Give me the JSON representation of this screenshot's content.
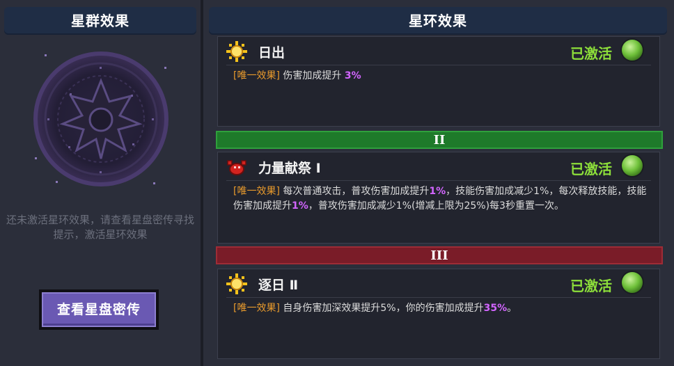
{
  "left": {
    "title": "星群效果",
    "hint": "还未激活星环效果，请查看星盘密传寻找提示，激活星环效果",
    "button_label": "查看星盘密传"
  },
  "right": {
    "title": "星环效果",
    "tiers": [
      {
        "label": "II",
        "color": "#1e7a2a"
      },
      {
        "label": "III",
        "color": "#7a1c28"
      }
    ],
    "cards": [
      {
        "name": "日出",
        "icon": "sun-icon",
        "status": "已激活",
        "tag": "[唯一效果]",
        "desc_parts": [
          " 伤害加成提升 ",
          "3%"
        ]
      },
      {
        "name": "力量献祭 Ⅰ",
        "icon": "red-crab-icon",
        "status": "已激活",
        "tag": "[唯一效果]",
        "desc_parts": [
          " 每次普通攻击，普攻伤害加成提升",
          "1%",
          "，技能伤害加成减少1%，每次释放技能，技能伤害加成提升",
          "1%",
          "，普攻伤害加成减少1%(增减上限为25%)每3秒重置一次。"
        ]
      },
      {
        "name": "逐日 Ⅱ",
        "icon": "sun-icon",
        "status": "已激活",
        "tag": "[唯一效果]",
        "desc_parts": [
          " 自身伤害加深效果提升5%，你的伤害加成提升",
          "35%",
          "。"
        ]
      }
    ]
  },
  "colors": {
    "active_status": "#8ddf3a",
    "tag": "#e89a2c",
    "highlight": "#d265ff",
    "button": "#6a59b3"
  }
}
